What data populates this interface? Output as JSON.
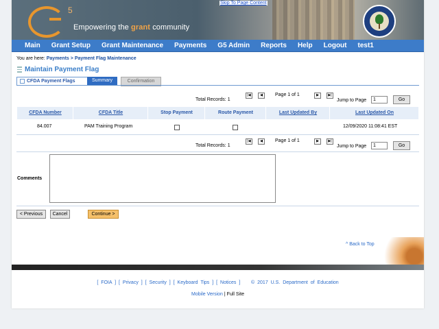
{
  "header": {
    "skip_link": "Skip To Page Content",
    "logo_text": "G",
    "logo_num": "5",
    "tagline_pre": "Empowering the ",
    "tagline_grant": "grant",
    "tagline_post": " community",
    "seal_icon": "department-of-education-seal-icon"
  },
  "nav": {
    "items": [
      "Main",
      "Grant Setup",
      "Grant Maintenance",
      "Payments",
      "G5 Admin",
      "Reports",
      "Help",
      "Logout",
      "test1"
    ]
  },
  "breadcrumb": {
    "prefix": "You are here:",
    "crumb1": "Payments",
    "separator": ">",
    "crumb2": "Payment Flag Maintenance"
  },
  "page_title": "Maintain Payment Flag",
  "tabs": {
    "active": "CFDA Payment Flags",
    "summary": "Summary",
    "confirmation": "Confirmation"
  },
  "pager_top": {
    "total_label": "Total Records:",
    "total": "1",
    "page_label": "Page 1 of 1",
    "jump_label": "Jump to Page",
    "jump_value": "1",
    "go": "Go",
    "first": "|◀",
    "prev": "◀",
    "next": "▶",
    "last": "▶|"
  },
  "pager_bottom": {
    "total_label": "Total Records:",
    "total": "1",
    "page_label": "Page 1 of 1",
    "jump_label": "Jump to Page",
    "jump_value": "1",
    "go": "Go",
    "first": "|◀",
    "prev": "◀",
    "next": "▶",
    "last": "▶|"
  },
  "table": {
    "headers": [
      "CFDA Number",
      "CFDA Title",
      "Stop Payment",
      "Route Payment",
      "Last Updated By",
      "Last Updated On"
    ],
    "rows": [
      {
        "cfda_number": "84.007",
        "cfda_title": "PAM Training Program",
        "stop_payment": false,
        "route_payment": false,
        "last_updated_by": "",
        "last_updated_on": "12/09/2020 11:08:41 EST"
      }
    ]
  },
  "comments": {
    "label": "Comments",
    "value": ""
  },
  "buttons": {
    "previous": "< Previous",
    "cancel": "Cancel",
    "continue": "Continue >"
  },
  "back_to_top": "^ Back to Top",
  "footer": {
    "links": "[ FOIA ] [ Privacy ] [ Security ] [ Keyboard Tips ] [ Notices ]",
    "copyright": "© 2017 U.S. Department of Education",
    "mobile": "Mobile Version",
    "sep": "|",
    "full_site": "Full Site"
  },
  "colors": {
    "nav_bg": "#3d7cc9",
    "accent_orange": "#e8962d",
    "link_blue": "#2a6ac8"
  }
}
